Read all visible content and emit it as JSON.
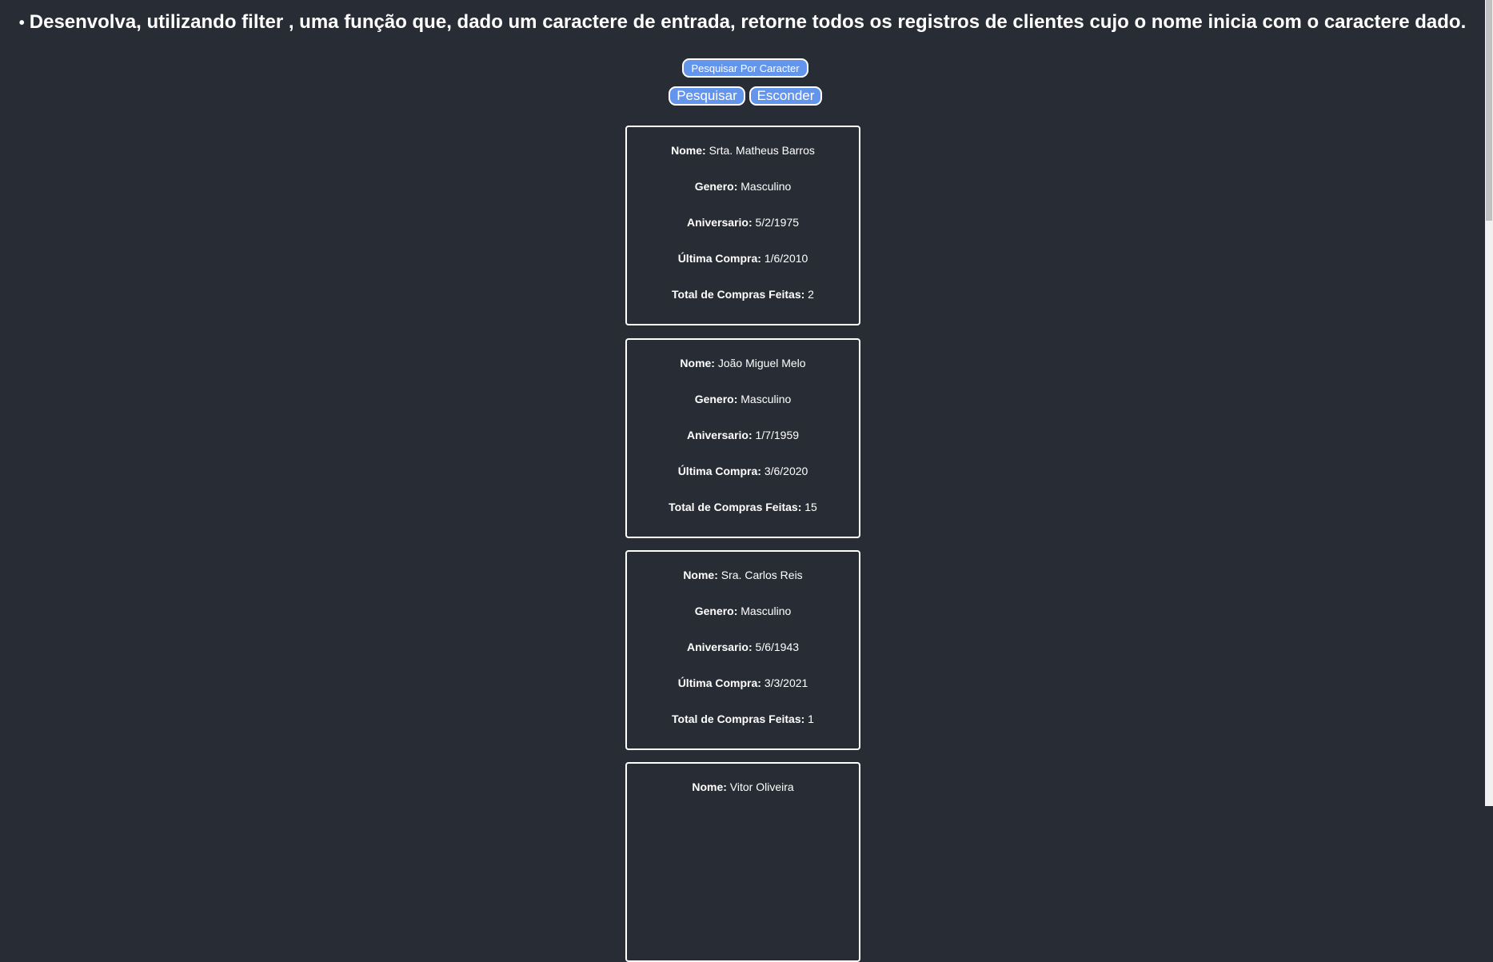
{
  "heading": {
    "bullet": "•",
    "text": "Desenvolva, utilizando filter , uma função que, dado um caractere de entrada, retorne todos os registros de clientes cujo o nome inicia com o caractere dado."
  },
  "buttons": {
    "search_by_char": "Pesquisar Por Caracter",
    "search": "Pesquisar",
    "hide": "Esconder"
  },
  "labels": {
    "name": "Nome:",
    "gender": "Genero:",
    "birthday": "Aniversario:",
    "last_purchase": "Última Compra:",
    "total": "Total de Compras Feitas:"
  },
  "clients": [
    {
      "name": "Srta. Matheus Barros",
      "gender": "Masculino",
      "birthday": "5/2/1975",
      "last_purchase": "1/6/2010",
      "total": "2"
    },
    {
      "name": "João Miguel Melo",
      "gender": "Masculino",
      "birthday": "1/7/1959",
      "last_purchase": "3/6/2020",
      "total": "15"
    },
    {
      "name": "Sra. Carlos Reis",
      "gender": "Masculino",
      "birthday": "5/6/1943",
      "last_purchase": "3/3/2021",
      "total": "1"
    },
    {
      "name": "Vitor Oliveira"
    }
  ],
  "colors": {
    "background": "#282c34",
    "button": "#6495ed"
  }
}
